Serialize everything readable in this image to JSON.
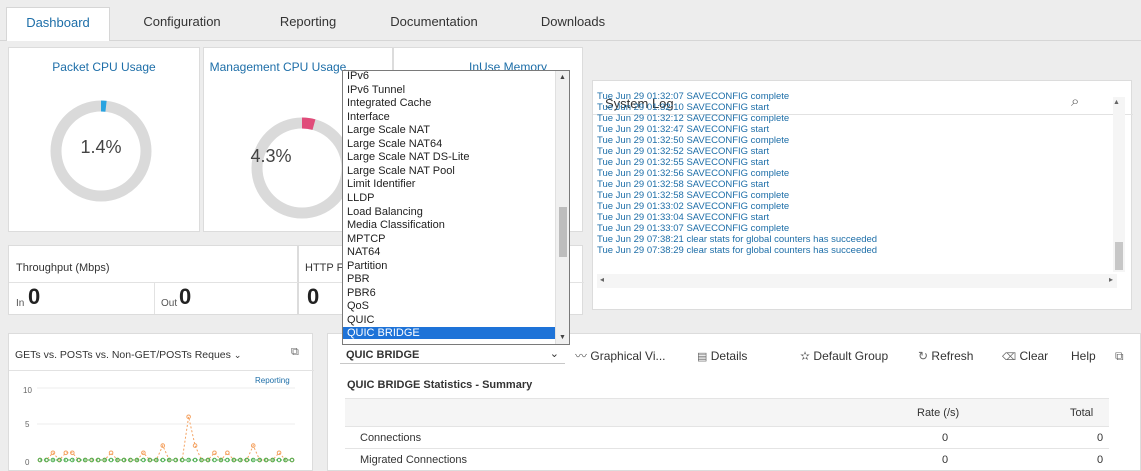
{
  "tabs": [
    "Dashboard",
    "Configuration",
    "Reporting",
    "Documentation",
    "Downloads"
  ],
  "gauges": {
    "packet_cpu": {
      "title": "Packet CPU Usage",
      "value": "1.4%",
      "percent": 1.4,
      "color": "#29a3e0"
    },
    "mgmt_cpu": {
      "title": "Management CPU Usage",
      "value": "4.3%",
      "percent": 4.3,
      "color": "#e04c7a"
    },
    "memory": {
      "title": "InUse Memory"
    }
  },
  "throughput": {
    "title": "Throughput (Mbps)",
    "in_label": "In",
    "in_value": "0",
    "out_label": "Out",
    "out_value": "0"
  },
  "http": {
    "title_fragment": "HTTP F",
    "value": "0"
  },
  "dropdown": {
    "items": [
      "IPv6",
      "IPv6 Tunnel",
      "Integrated Cache",
      "Interface",
      "Large Scale NAT",
      "Large Scale NAT64",
      "Large Scale NAT DS-Lite",
      "Large Scale NAT Pool",
      "Limit Identifier",
      "LLDP",
      "Load Balancing",
      "Media Classification",
      "MPTCP",
      "NAT64",
      "Partition",
      "PBR",
      "PBR6",
      "QoS",
      "QUIC",
      "QUIC BRIDGE"
    ],
    "selected": "QUIC BRIDGE"
  },
  "syslog": {
    "title": "System Log",
    "lines": [
      "Tue Jun 29 01:32:07 SAVECONFIG complete",
      "Tue Jun 29 01:32:10 SAVECONFIG start",
      "Tue Jun 29 01:32:12 SAVECONFIG complete",
      "Tue Jun 29 01:32:47 SAVECONFIG start",
      "Tue Jun 29 01:32:50 SAVECONFIG complete",
      "Tue Jun 29 01:32:52 SAVECONFIG start",
      "Tue Jun 29 01:32:55 SAVECONFIG start",
      "Tue Jun 29 01:32:56 SAVECONFIG complete",
      "Tue Jun 29 01:32:58 SAVECONFIG start",
      "Tue Jun 29 01:32:58 SAVECONFIG complete",
      "Tue Jun 29 01:33:02 SAVECONFIG complete",
      "Tue Jun 29 01:33:04 SAVECONFIG start",
      "Tue Jun 29 01:33:07 SAVECONFIG complete",
      "Tue Jun 29 07:38:21 clear stats for global counters has succeeded",
      "Tue Jun 29 07:38:29 clear stats for global counters has succeeded"
    ]
  },
  "requests_chart": {
    "title": "GETs vs. POSTs vs. Non-GET/POSTs Reques",
    "link": "Reporting",
    "y_ticks": [
      "10",
      "5",
      "0"
    ]
  },
  "chart_data": {
    "type": "line",
    "ylim": [
      0,
      10
    ],
    "series": [
      {
        "color": "#f4a261",
        "values": [
          0,
          0,
          1,
          0,
          1,
          1,
          0,
          0,
          0,
          0,
          0,
          1,
          0,
          0,
          0,
          0,
          1,
          0,
          0,
          2,
          0,
          0,
          0,
          6,
          2,
          0,
          0,
          1,
          0,
          1,
          0,
          0,
          0,
          2,
          0,
          0,
          0,
          1,
          0,
          0
        ]
      },
      {
        "color": "#4caf50",
        "values": [
          0,
          0,
          0,
          0,
          0,
          0,
          0,
          0,
          0,
          0,
          0,
          0,
          0,
          0,
          0,
          0,
          0,
          0,
          0,
          0,
          0,
          0,
          0,
          0,
          0,
          0,
          0,
          0,
          0,
          0,
          0,
          0,
          0,
          0,
          0,
          0,
          0,
          0,
          0,
          0
        ]
      }
    ]
  },
  "stats": {
    "select_value": "QUIC BRIDGE",
    "graphical": "Graphical Vi...",
    "details": "Details",
    "default_group": "Default Group",
    "refresh": "Refresh",
    "clear": "Clear",
    "help": "Help",
    "summary_title": "QUIC BRIDGE Statistics - Summary",
    "col_rate": "Rate (/s)",
    "col_total": "Total",
    "rows": [
      {
        "name": "Connections",
        "rate": "0",
        "total": "0"
      },
      {
        "name": "Migrated Connections",
        "rate": "0",
        "total": "0"
      }
    ]
  }
}
